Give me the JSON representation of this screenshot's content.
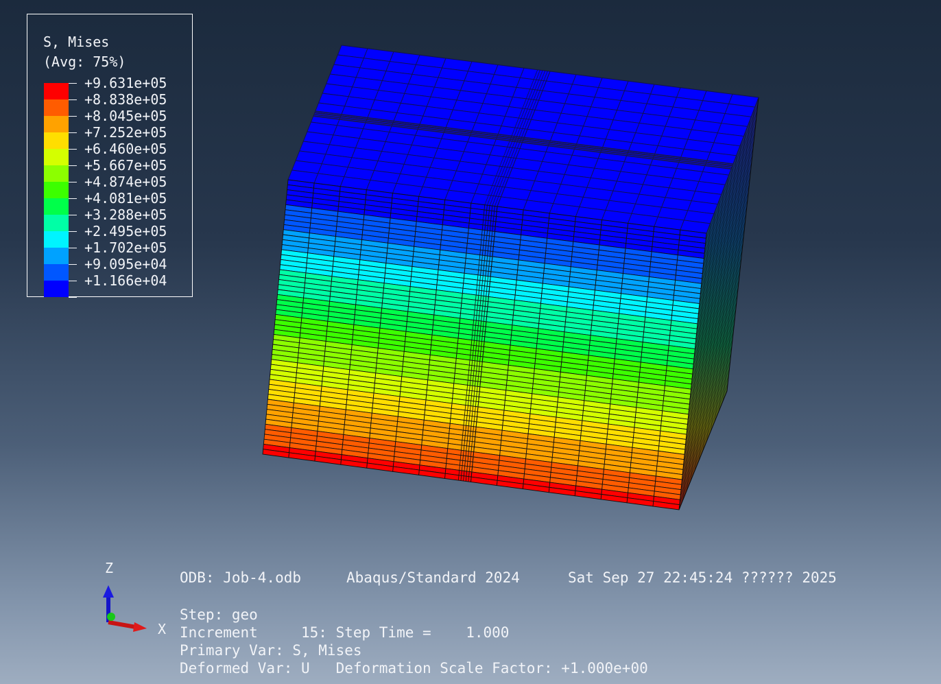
{
  "legend": {
    "title": "S, Mises",
    "subtitle": "(Avg: 75%)",
    "levels": [
      {
        "label": "+9.631e+05",
        "color": "#ff0000"
      },
      {
        "label": "+8.838e+05",
        "color": "#ff5c00"
      },
      {
        "label": "+8.045e+05",
        "color": "#ffa200"
      },
      {
        "label": "+7.252e+05",
        "color": "#ffde00"
      },
      {
        "label": "+6.460e+05",
        "color": "#d4ff00"
      },
      {
        "label": "+5.667e+05",
        "color": "#8cff00"
      },
      {
        "label": "+4.874e+05",
        "color": "#3cff00"
      },
      {
        "label": "+4.081e+05",
        "color": "#00ff4a"
      },
      {
        "label": "+3.288e+05",
        "color": "#00ffa6"
      },
      {
        "label": "+2.495e+05",
        "color": "#00f4ff"
      },
      {
        "label": "+1.702e+05",
        "color": "#00a2ff"
      },
      {
        "label": "+9.095e+04",
        "color": "#0057ff"
      },
      {
        "label": "+1.166e+04",
        "color": "#0000ff"
      }
    ]
  },
  "triad": {
    "z_label": "Z",
    "x_label": "X"
  },
  "info": {
    "odb": "ODB: Job-4.odb",
    "solver": "Abaqus/Standard 2024",
    "timestamp": "Sat Sep 27 22:45:24 ?????? 2025",
    "step": "Step: geo",
    "increment": "Increment     15: Step Time =    1.000",
    "primary_var": "Primary Var: S, Mises",
    "deformed_var": "Deformed Var: U   Deformation Scale Factor: +1.000e+00"
  }
}
